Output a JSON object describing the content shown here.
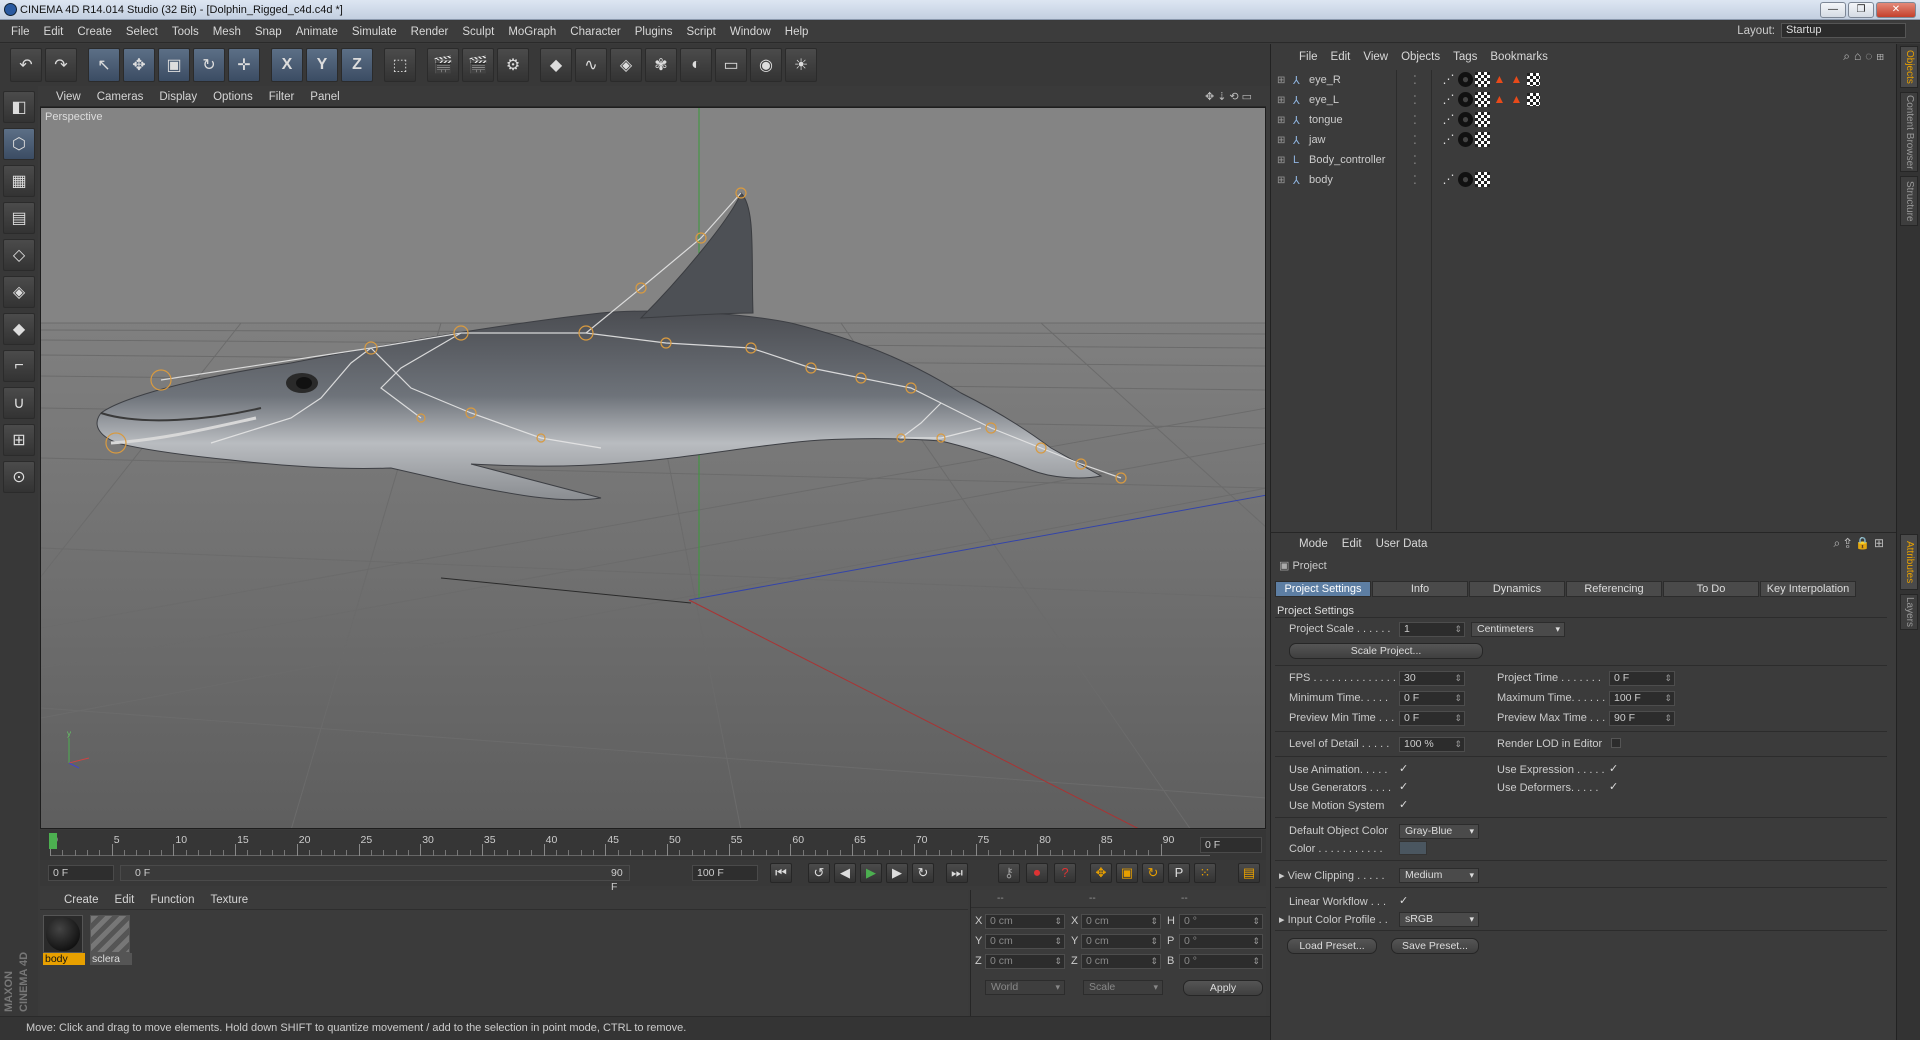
{
  "window": {
    "title": "CINEMA 4D R14.014 Studio (32 Bit) - [Dolphin_Rigged_c4d.c4d *]",
    "controls": [
      "—",
      "❐",
      "✕"
    ]
  },
  "menubar": [
    "File",
    "Edit",
    "Create",
    "Select",
    "Tools",
    "Mesh",
    "Snap",
    "Animate",
    "Simulate",
    "Render",
    "Sculpt",
    "MoGraph",
    "Character",
    "Plugins",
    "Script",
    "Window",
    "Help"
  ],
  "layout": {
    "label": "Layout:",
    "value": "Startup"
  },
  "toolbar_icons": [
    "undo-icon",
    "redo-icon",
    "live-select-icon",
    "move-icon",
    "scale-icon",
    "rotate-icon",
    "recent-tool-icon",
    "x-axis-icon",
    "y-axis-icon",
    "z-axis-icon",
    "world-coord-icon",
    "render-view-icon",
    "render-picture-viewer-icon",
    "render-settings-icon",
    "cube-icon",
    "spline-icon",
    "nurbs-icon",
    "array-icon",
    "deformer-icon",
    "floor-icon",
    "camera-icon",
    "light-icon"
  ],
  "toolbar_glyphs": [
    "↶",
    "↷",
    "↖",
    "✥",
    "▣",
    "↻",
    "✛",
    "X",
    "Y",
    "Z",
    "⬚",
    "🎬",
    "🎬",
    "⚙",
    "◆",
    "∿",
    "◈",
    "✾",
    "◐",
    "▭",
    "◉",
    "☀"
  ],
  "left_tools": [
    "make-editable-icon",
    "model-mode-icon",
    "texture-mode-icon",
    "workplane-icon",
    "points-mode-icon",
    "edges-mode-icon",
    "polygons-mode-icon",
    "axis-icon",
    "magnet-icon",
    "snap-icon",
    "lock-workplane-icon"
  ],
  "viewport": {
    "menu": [
      "View",
      "Cameras",
      "Display",
      "Options",
      "Filter",
      "Panel"
    ],
    "label": "Perspective"
  },
  "timeline": {
    "ticks": [
      "0",
      "5",
      "10",
      "15",
      "20",
      "25",
      "30",
      "35",
      "40",
      "45",
      "50",
      "55",
      "60",
      "65",
      "70",
      "75",
      "80",
      "85",
      "90"
    ],
    "current_frame": "0 F"
  },
  "transport": {
    "start": "0 F",
    "range_start": "0 F",
    "range_end": "90 F",
    "end": "100 F",
    "buttons": [
      "⏮",
      "↺",
      "◀",
      "▶",
      "▶",
      "↻",
      "⏭"
    ]
  },
  "materials": {
    "menu": [
      "Create",
      "Edit",
      "Function",
      "Texture"
    ],
    "items": [
      {
        "name": "body",
        "selected": true
      },
      {
        "name": "sclera",
        "selected": false
      }
    ]
  },
  "coordinates": {
    "headers": [
      "--",
      "--",
      "--"
    ],
    "rows": [
      {
        "axis": "X",
        "pos": "0 cm",
        "axis2": "X",
        "size": "0 cm",
        "rot_axis": "H",
        "rot": "0 °"
      },
      {
        "axis": "Y",
        "pos": "0 cm",
        "axis2": "Y",
        "size": "0 cm",
        "rot_axis": "P",
        "rot": "0 °"
      },
      {
        "axis": "Z",
        "pos": "0 cm",
        "axis2": "Z",
        "size": "0 cm",
        "rot_axis": "B",
        "rot": "0 °"
      }
    ],
    "mode": "World",
    "scale": "Scale",
    "apply": "Apply"
  },
  "status": "Move: Click and drag to move elements. Hold down SHIFT to quantize movement / add to the selection in point mode, CTRL to remove.",
  "maxon_logo": "MAXON CINEMA 4D",
  "objects": {
    "menu": [
      "File",
      "Edit",
      "View",
      "Objects",
      "Tags",
      "Bookmarks"
    ],
    "items": [
      {
        "name": "eye_R",
        "tags": 5
      },
      {
        "name": "eye_L",
        "tags": 5
      },
      {
        "name": "tongue",
        "tags": 3
      },
      {
        "name": "jaw",
        "tags": 3
      },
      {
        "name": "Body_controller",
        "tags": 0
      },
      {
        "name": "body",
        "tags": 3
      }
    ]
  },
  "attributes": {
    "menu": [
      "Mode",
      "Edit",
      "User Data"
    ],
    "object": "Project",
    "tabs": [
      "Project Settings",
      "Info",
      "Dynamics",
      "Referencing",
      "To Do",
      "Key Interpolation"
    ],
    "section": "Project Settings",
    "project_scale": {
      "label": "Project Scale . . . . . .",
      "value": "1",
      "unit": "Centimeters"
    },
    "scale_project": "Scale Project...",
    "fps": {
      "label": "FPS . . . . . . . . . . . . . .",
      "value": "30"
    },
    "project_time": {
      "label": "Project Time . . . . . . .",
      "value": "0 F"
    },
    "min_time": {
      "label": "Minimum Time. . . . .",
      "value": "0 F"
    },
    "max_time": {
      "label": "Maximum Time. . . . . .",
      "value": "100 F"
    },
    "prev_min": {
      "label": "Preview Min Time . . .",
      "value": "0 F"
    },
    "prev_max": {
      "label": "Preview Max Time . . .",
      "value": "90 F"
    },
    "lod": {
      "label": "Level of Detail . . . . .",
      "value": "100 %"
    },
    "render_lod": "Render LOD in Editor",
    "use_animation": "Use Animation. . . . .",
    "use_expression": "Use Expression . . . . .",
    "use_generators": "Use Generators . . . .",
    "use_deformers": "Use Deformers. . . . .",
    "use_motion": "Use Motion System",
    "default_color": {
      "label": "Default Object Color",
      "value": "Gray-Blue"
    },
    "color_label": "Color . . . . . . . . . . .",
    "view_clipping": {
      "label": "View Clipping . . . . .",
      "value": "Medium"
    },
    "linear_workflow": "Linear Workflow . . .",
    "input_profile": {
      "label": "Input Color Profile . .",
      "value": "sRGB"
    },
    "load_preset": "Load Preset...",
    "save_preset": "Save Preset..."
  },
  "right_tabs": [
    "Objects",
    "Content Browser",
    "Structure",
    "Attributes",
    "Layers"
  ]
}
